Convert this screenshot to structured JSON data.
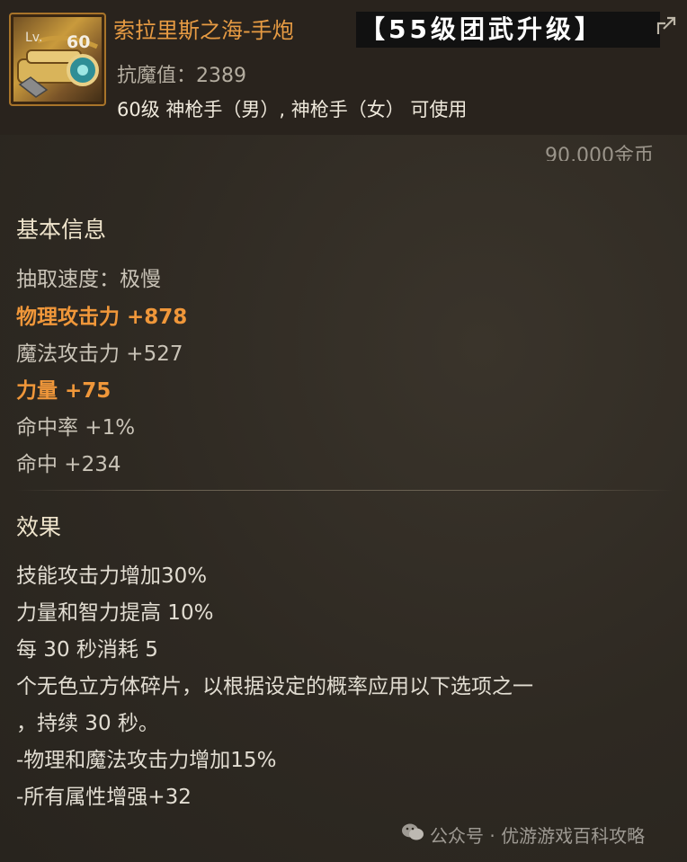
{
  "item": {
    "level_tag": "Lv.",
    "level": "60",
    "name": "索拉里斯之海-手炮",
    "magic_resist": "抗魔值：2389",
    "class_requirement": "60级 神枪手（男）, 神枪手（女） 可使用",
    "price": "90,000金币"
  },
  "banner": "【55级团武升级】",
  "basic_info": {
    "title": "基本信息",
    "lines": [
      {
        "text": "抽取速度：极慢",
        "highlight": false
      },
      {
        "text": "物理攻击力 +878",
        "highlight": true
      },
      {
        "text": "魔法攻击力 +527",
        "highlight": false
      },
      {
        "text": "力量 +75",
        "highlight": true
      },
      {
        "text": "命中率 +1%",
        "highlight": false
      },
      {
        "text": "命中 +234",
        "highlight": false
      }
    ]
  },
  "effects": {
    "title": "效果",
    "lines": [
      "技能攻击力增加30%",
      "力量和智力提高 10%",
      "每 30 秒消耗 5",
      "个无色立方体碎片，以根据设定的概率应用以下选项之一",
      "，持续 30 秒。",
      "-物理和魔法攻击力增加15%",
      "-所有属性增强+32"
    ]
  },
  "watermark": "公众号 · 优游游戏百科攻略",
  "colors": {
    "title_orange": "#e79b43",
    "highlight_orange": "#f0973a",
    "background": "#2f2a23"
  },
  "icons": [
    "hand-cannon-icon",
    "share-icon",
    "wechat-icon"
  ]
}
